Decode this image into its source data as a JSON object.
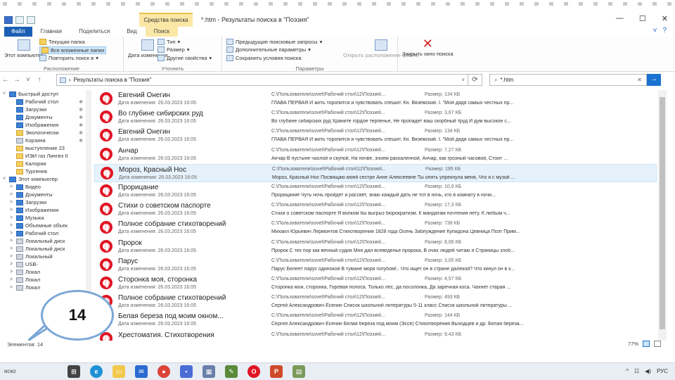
{
  "window": {
    "title": "*.htm - Результаты поиска в \"Поэзия\"",
    "context_tab": "Средства поиска",
    "controls": [
      "—",
      "☐",
      "✕"
    ]
  },
  "ribbon_tabs": [
    {
      "label": "Файл"
    },
    {
      "label": "Главная"
    },
    {
      "label": "Поделиться"
    },
    {
      "label": "Вид"
    },
    {
      "label": "Поиск"
    }
  ],
  "ribbon": {
    "location": {
      "label": "Расположение",
      "this_computer": "Этот компьютер",
      "current_folder": "Текущая папка",
      "all_subfolders": "Все вложенные папки",
      "search_again": "Повторить поиск в"
    },
    "refine": {
      "label": "Уточнить",
      "date_modified": "Дата изменения",
      "type": "Тип",
      "size": "Размер",
      "other_props": "Другие свойства"
    },
    "options": {
      "label": "Параметры",
      "recent": "Предыдущие поисковые запросы",
      "advanced": "Дополнительные параметры",
      "save": "Сохранить условия поиска",
      "open_location": "Открыть расположение файла"
    },
    "close": {
      "label": "Закрыть окно поиска"
    }
  },
  "address": {
    "path": "Результаты поиска в \"Поэзия\"",
    "search_value": "*.htm"
  },
  "nav_pane": [
    {
      "label": "Быстрый доступ",
      "icon": "star-icon",
      "expander": "˅",
      "pin": false
    },
    {
      "label": "Рабочий стол",
      "icon": "desktop-icon",
      "pin": true
    },
    {
      "label": "Загрузки",
      "icon": "download-icon",
      "pin": true
    },
    {
      "label": "Документы",
      "icon": "documents-icon",
      "pin": true
    },
    {
      "label": "Изображения",
      "icon": "pictures-icon",
      "pin": true
    },
    {
      "label": "Экологически",
      "icon": "folder-icon",
      "pin": true
    },
    {
      "label": "Корзина",
      "icon": "recycle-bin-icon",
      "pin": true
    },
    {
      "label": "выступление 23",
      "icon": "folder-icon",
      "pin": false
    },
    {
      "label": "ИЭИ газ Лингвэ II",
      "icon": "folder-icon",
      "pin": false
    },
    {
      "label": "Калории",
      "icon": "folder-icon",
      "pin": false
    },
    {
      "label": "Тургенев",
      "icon": "folder-icon",
      "pin": false
    },
    {
      "label": "Этот компьютер",
      "icon": "computer-icon",
      "expander": "˅",
      "pin": false
    },
    {
      "label": "Видео",
      "icon": "video-icon",
      "expander": ">",
      "pin": false
    },
    {
      "label": "Документы",
      "icon": "documents-icon",
      "expander": ">",
      "pin": false
    },
    {
      "label": "Загрузки",
      "icon": "download-icon",
      "expander": ">",
      "pin": false
    },
    {
      "label": "Изображения",
      "icon": "pictures-icon",
      "expander": ">",
      "pin": false
    },
    {
      "label": "Музыка",
      "icon": "music-icon",
      "expander": ">",
      "pin": false
    },
    {
      "label": "Объемные объек",
      "icon": "3d-objects-icon",
      "expander": ">",
      "pin": false
    },
    {
      "label": "Рабочий стол",
      "icon": "desktop-icon",
      "expander": ">",
      "pin": false
    },
    {
      "label": "Локальный диск",
      "icon": "drive-icon",
      "expander": ">",
      "pin": false
    },
    {
      "label": "Локальный диск",
      "icon": "drive-icon",
      "expander": ">",
      "pin": false
    },
    {
      "label": "Локальный",
      "icon": "drive-icon",
      "expander": ">",
      "pin": false
    },
    {
      "label": "USB-",
      "icon": "usb-icon",
      "expander": ">",
      "pin": false
    },
    {
      "label": "Локал",
      "icon": "drive-icon",
      "expander": ">",
      "pin": false
    },
    {
      "label": "Локал",
      "icon": "drive-icon",
      "expander": ">",
      "pin": false
    },
    {
      "label": "Локал",
      "icon": "drive-icon",
      "expander": ">",
      "pin": false
    }
  ],
  "files": [
    {
      "name": "Евгений Онегин",
      "date": "Дата изменения: 26.03.2023 16:05",
      "path": "C:\\Пользователи\\sovet\\Рабочий стол\\12\\Поэзия\\...",
      "size": "Размер: 134 КБ",
      "snippet": "ГЛАВА ПЕРВАЯ И жить торопится и чувствовать спешит. Кн. Вяземский. I. \"Мой дядя самых честных пр..."
    },
    {
      "name": "Во глубине сибирских руд",
      "date": "Дата изменения: 26.03.2023 16:05",
      "path": "C:\\Пользователи\\sovet\\Рабочий стол\\12\\Поэзия\\...",
      "size": "Размер: 3,67 КБ",
      "snippet": "Во глубине сибирских руд Храните гордое терпенье, Не пропадет ваш скорбный труд И дум высокое с..."
    },
    {
      "name": "Евгений Онегин",
      "date": "Дата изменения: 26.03.2023 16:05",
      "path": "C:\\Пользователи\\sovet\\Рабочий стол\\12\\Поэзия\\...",
      "size": "Размер: 134 КБ",
      "snippet": "ГЛАВА ПЕРВАЯ И жить торопится и чувствовать спешит. Кн. Вяземский. I. \"Мой дядя самых честных пр..."
    },
    {
      "name": "Анчар",
      "date": "Дата изменения: 26.03.2023 16:05",
      "path": "C:\\Пользователи\\sovet\\Рабочий стол\\12\\Поэзия\\...",
      "size": "Размер: 7,27 КБ",
      "snippet": "Анчар В пустыне чахлой и скупой, На почве, зноем раскаленной, Анчар, как грозный часовой, Стоит ..."
    },
    {
      "name": "Мороз, Красный Нос",
      "date": "Дата изменения: 26.03.2023 16:05",
      "path": "C:\\Пользователи\\sovet\\Рабочий стол\\12\\Поэзия\\...",
      "size": "Размер: 195 КБ",
      "snippet": "Мороз, Красный Нос Посвящаю моей сестре Анне Алексеевне Ты опять упрекнула меня, Что я с музой ..."
    },
    {
      "name": "Прорицание",
      "date": "Дата изменения: 26.03.2023 16:05",
      "path": "C:\\Пользователи\\sovet\\Рабочий стол\\12\\Поэзия\\...",
      "size": "Размер: 10,9 КБ",
      "snippet": "Прорицание Чуть ночь пройдет и рассвет, знаю каждый дать не тот в ночь, кто в комнату в ночи..."
    },
    {
      "name": "Стихи о советском паспорте",
      "date": "Дата изменения: 26.03.2023 16:05",
      "path": "C:\\Пользователи\\sovet\\Рабочий стол\\12\\Поэзия\\...",
      "size": "Размер: 17,3 КБ",
      "snippet": "Стихи о советском паспорте Я волком бы выгрыз бюрократизм. К мандатам почтения нету. К любым ч..."
    },
    {
      "name": "Полное собрание стихотворений",
      "date": "Дата изменения: 26.03.2023 16:05",
      "path": "C:\\Пользователи\\sovet\\Рабочий стол\\12\\Поэзия\\...",
      "size": "Размер: 738 КБ",
      "snippet": "Михаил Юрьевич Лермонтов Стихотворения 1828 года Осень Заблуждение Купидона Цевница Поэт Прим..."
    },
    {
      "name": "Пророк",
      "date": "Дата изменения: 26.03.2023 16:05",
      "path": "C:\\Пользователи\\sovet\\Рабочий стол\\12\\Поэзия\\...",
      "size": "Размер: 8,06 КБ",
      "snippet": "Пророк С тех пор как вечный судия Мне дал всеведенье пророка, В очах людей читаю я Страницы злоб..."
    },
    {
      "name": "Парус",
      "date": "Дата изменения: 26.03.2023 16:05",
      "path": "C:\\Пользователи\\sovet\\Рабочий стол\\12\\Поэзия\\...",
      "size": "Размер: 3,05 КБ",
      "snippet": "Парус Белеет парус одинокой В тумане моря голубом!.. Что ищет он в стране далекой? Что кинул он в к..."
    },
    {
      "name": "Сторонка моя, сторонка",
      "date": "Дата изменения: 26.03.2023 16:05",
      "path": "C:\\Пользователи\\sovet\\Рабочий стол\\12\\Поэзия\\...",
      "size": "Размер: 4,57 КБ",
      "snippet": "Сторонка моя, сторонка, Горевая полоса. Только лес, да посолонка, Да заречная коса. Чахнет старая ..."
    },
    {
      "name": "Полное собрание стихотворений",
      "date": "Дата изменения: 26.03.2023 16:05",
      "path": "C:\\Пользователи\\sovet\\Рабочий стол\\12\\Поэзия\\...",
      "size": "Размер: 493 КБ",
      "snippet": "Сергей Александрович Есенин Список школьной литературы 5-11 класс Список школьной литературы ..."
    },
    {
      "name": "Белая береза под моим окном...",
      "date": "Дата изменения: 26.03.2023 16:05",
      "path": "C:\\Пользователи\\sovet\\Рабочий стол\\12\\Поэзия\\...",
      "size": "Размер: 144 КБ",
      "snippet": "Сергей Александрович Есенин Белая береза под моим (Эссе) Стихотворения Выходцев и др. Белая береза..."
    },
    {
      "name": "Хрестоматия. Стихотворения",
      "date": "",
      "path": "C:\\Пользователи\\sovet\\Рабочий стол\\12\\Поэзия\\...",
      "size": "Размер: 9,43 КБ",
      "snippet": ""
    }
  ],
  "status": {
    "count": "Элементов: 14",
    "zoom": "77%"
  },
  "callout": {
    "number": "14"
  },
  "taskbar": {
    "search_label": "иско",
    "tray_lang": "РУС"
  }
}
